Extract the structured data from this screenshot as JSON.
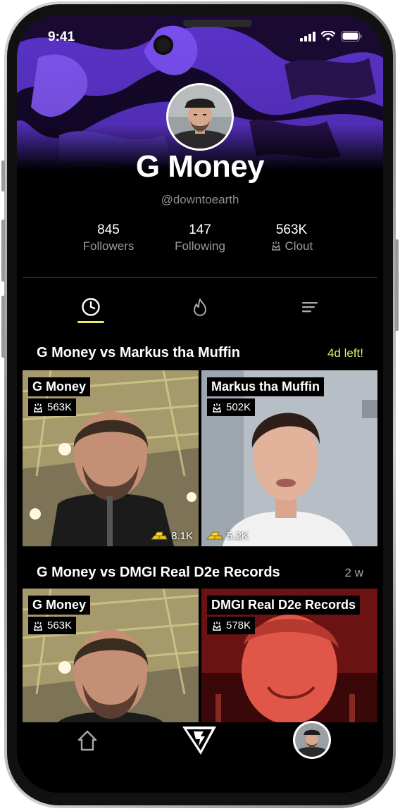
{
  "status_bar": {
    "time": "9:41"
  },
  "profile": {
    "name": "G Money",
    "handle": "@downtoearth",
    "stats": [
      {
        "value": "845",
        "label": "Followers"
      },
      {
        "value": "147",
        "label": "Following"
      },
      {
        "value": "563K",
        "label": "Clout",
        "icon": "clout-icon"
      }
    ]
  },
  "tabs": [
    {
      "name": "recent",
      "icon": "clock-icon",
      "active": true
    },
    {
      "name": "hot",
      "icon": "flame-icon",
      "active": false
    },
    {
      "name": "list",
      "icon": "list-icon",
      "active": false
    }
  ],
  "battles": [
    {
      "title": "G Money vs Markus tha Muffin",
      "time_left": "4d left!",
      "left": {
        "name": "G Money",
        "clout": "563K",
        "tips": "8.1K"
      },
      "right": {
        "name": "Markus tha Muffin",
        "clout": "502K",
        "tips": "5.2K"
      }
    },
    {
      "title": "G Money vs DMGI Real D2e Records",
      "time_left": "2 w",
      "left": {
        "name": "G Money",
        "clout": "563K"
      },
      "right": {
        "name": "DMGI Real D2e Records",
        "clout": "578K"
      }
    }
  ],
  "nav": [
    {
      "name": "home",
      "icon": "home-icon"
    },
    {
      "name": "brand",
      "icon": "logo-icon"
    },
    {
      "name": "profile",
      "icon": "avatar"
    }
  ],
  "colors": {
    "accent": "#e9ec6b",
    "cover": "#6f3fe0",
    "background": "#000000",
    "time_left": "#e9ec6b"
  }
}
